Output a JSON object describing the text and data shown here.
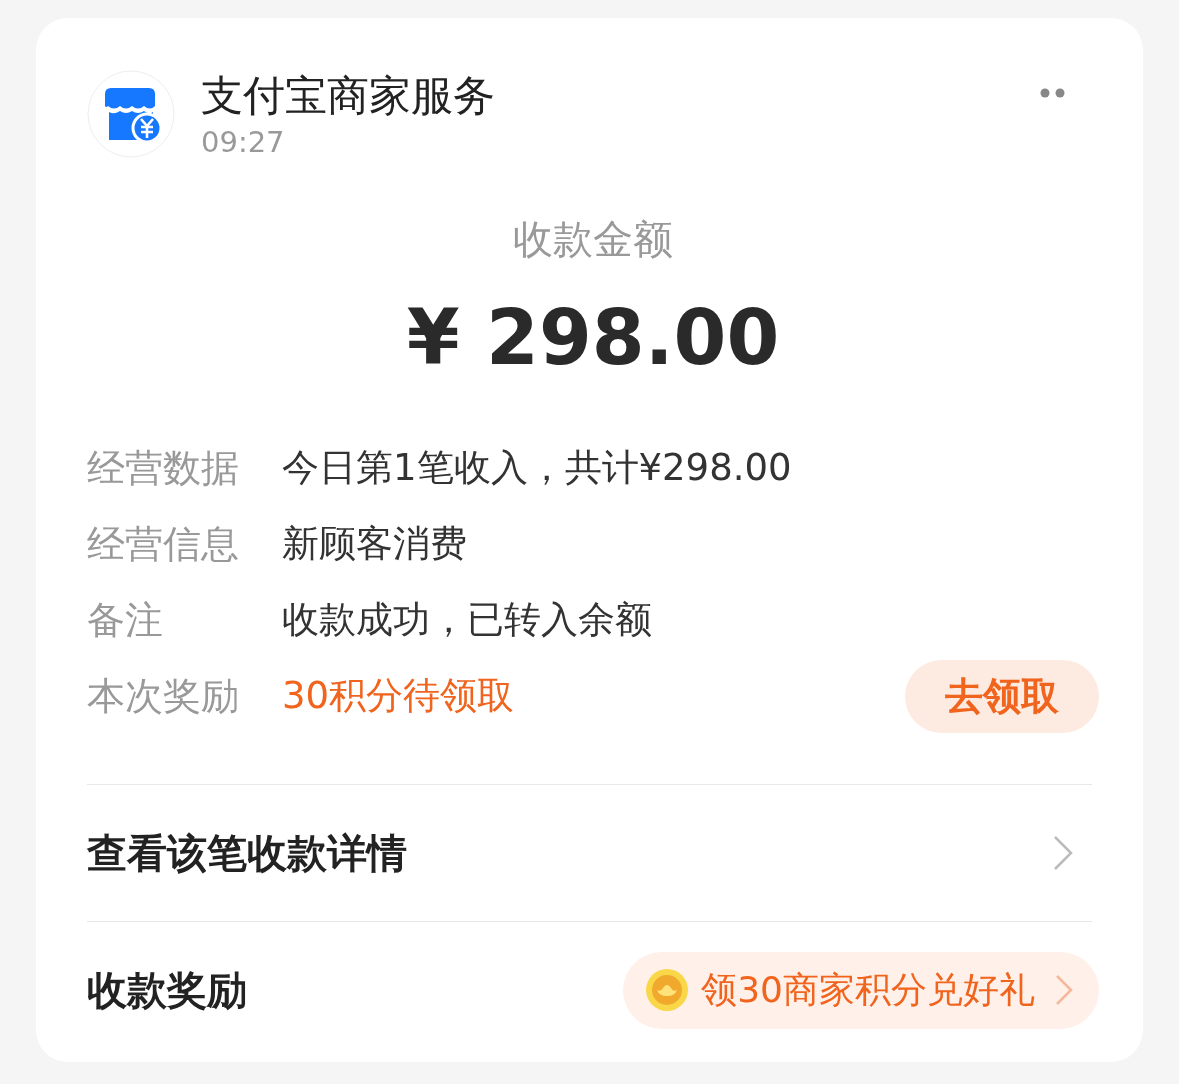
{
  "header": {
    "app_name": "支付宝商家服务",
    "time": "09:27"
  },
  "amount": {
    "label": "收款金额",
    "value": "¥ 298.00"
  },
  "details": [
    {
      "label": "经营数据",
      "value": "今日第1笔收入，共计¥298.00",
      "kind": "text"
    },
    {
      "label": "经营信息",
      "value": "新顾客消费",
      "kind": "text"
    },
    {
      "label": "备注",
      "value": "收款成功，已转入余额",
      "kind": "text"
    },
    {
      "label": "本次奖励",
      "value": "30积分待领取",
      "kind": "reward",
      "action": "去领取"
    }
  ],
  "links": [
    {
      "label": "查看该笔收款详情",
      "kind": "chevron"
    },
    {
      "label": "收款奖励",
      "kind": "promo",
      "promo": "领30商家积分兑好礼"
    }
  ]
}
